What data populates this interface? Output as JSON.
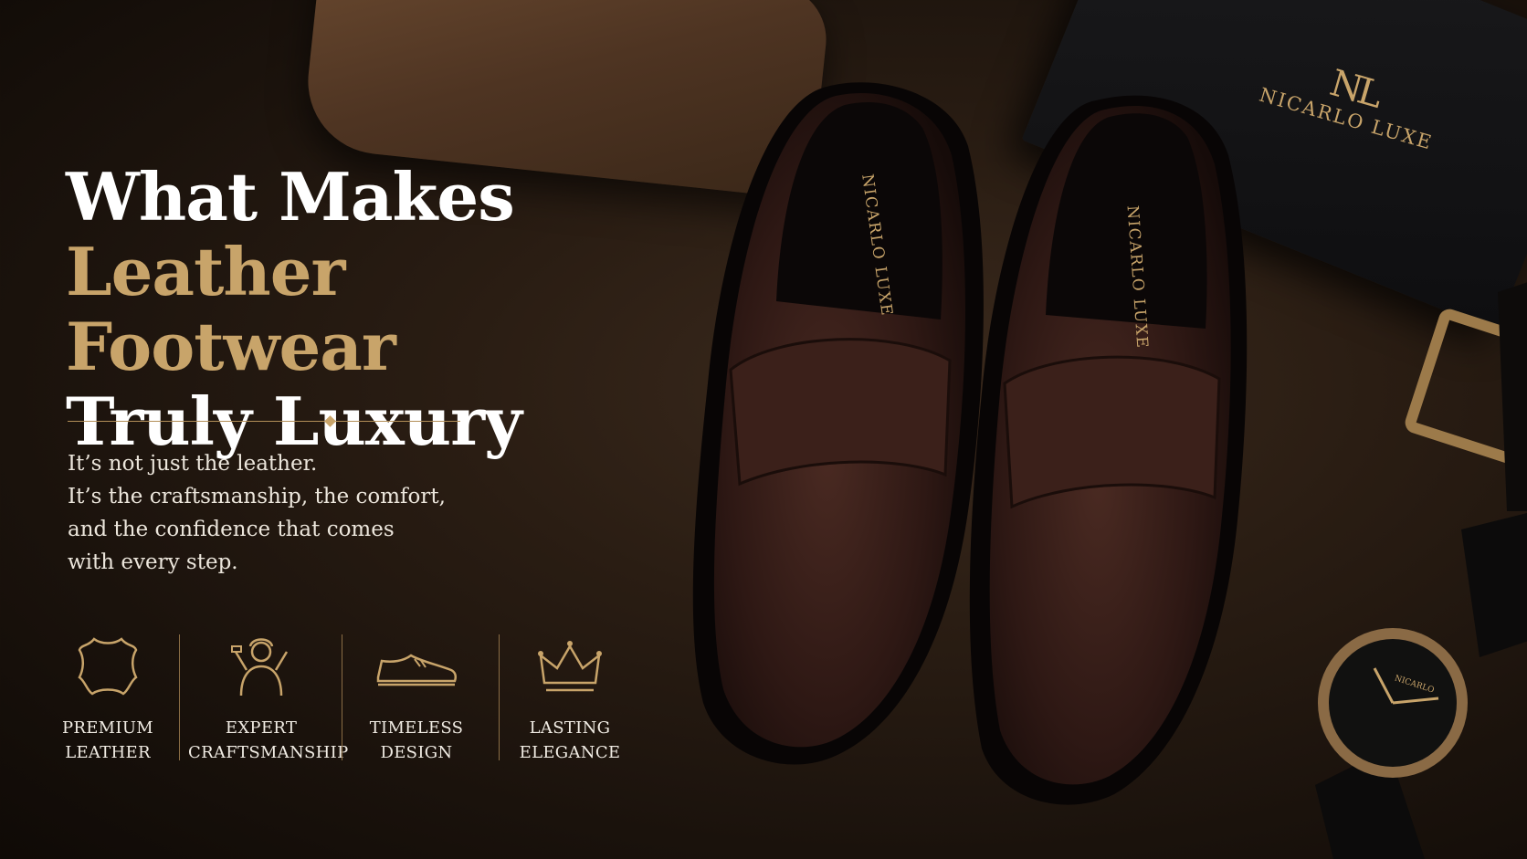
{
  "headline": {
    "line1": "What Makes",
    "line2": "Leather Footwear",
    "line3": "Truly Luxury"
  },
  "body_copy": [
    "It’s not just the leather.",
    "It’s the craftsmanship, the comfort,",
    "and the confidence that comes",
    "with every step."
  ],
  "features": [
    {
      "icon": "leather-hide-icon",
      "line1": "PREMIUM",
      "line2": "LEATHER"
    },
    {
      "icon": "craftsman-icon",
      "line1": "EXPERT",
      "line2": "CRAFTSMANSHIP"
    },
    {
      "icon": "shoe-icon",
      "line1": "TIMELESS",
      "line2": "DESIGN"
    },
    {
      "icon": "crown-icon",
      "line1": "LASTING",
      "line2": "ELEGANCE"
    }
  ],
  "brand": {
    "monogram": "NL",
    "name": "NICARLO LUXE",
    "watch_name": "NICARLO"
  },
  "colors": {
    "gold": "#c8a46a",
    "white": "#ffffff",
    "background": "#2a1d13"
  }
}
